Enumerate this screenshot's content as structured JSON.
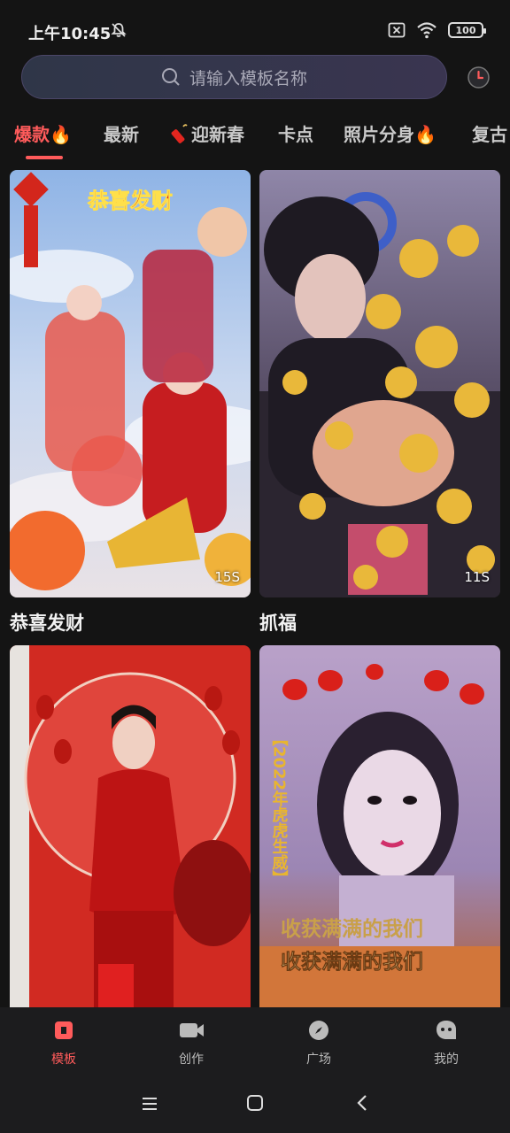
{
  "status_bar": {
    "time": "上午10:45",
    "battery": "100"
  },
  "search": {
    "placeholder": "请输入模板名称"
  },
  "tabs": [
    {
      "label": "爆款",
      "hot": true
    },
    {
      "label": "最新",
      "hot": false
    },
    {
      "label": "迎新春",
      "hot": false
    },
    {
      "label": "卡点",
      "hot": false
    },
    {
      "label": "照片分身",
      "hot": true
    },
    {
      "label": "复古",
      "hot": false
    }
  ],
  "cards": [
    {
      "title": "恭喜发财",
      "duration": "15S",
      "overlay_text": "恭喜发财"
    },
    {
      "title": "抓福",
      "duration": "11S"
    },
    {
      "title": "",
      "duration": ""
    },
    {
      "title": "",
      "duration": "",
      "overlay_text_1": "【2022年虎虎生威】",
      "overlay_text_2": "收获满满的我们"
    }
  ],
  "bottom_nav": [
    {
      "label": "模板",
      "active": true
    },
    {
      "label": "创作",
      "active": false
    },
    {
      "label": "广场",
      "active": false
    },
    {
      "label": "我的",
      "active": false
    }
  ],
  "colors": {
    "accent": "#ff5b5b",
    "background": "#141414"
  }
}
